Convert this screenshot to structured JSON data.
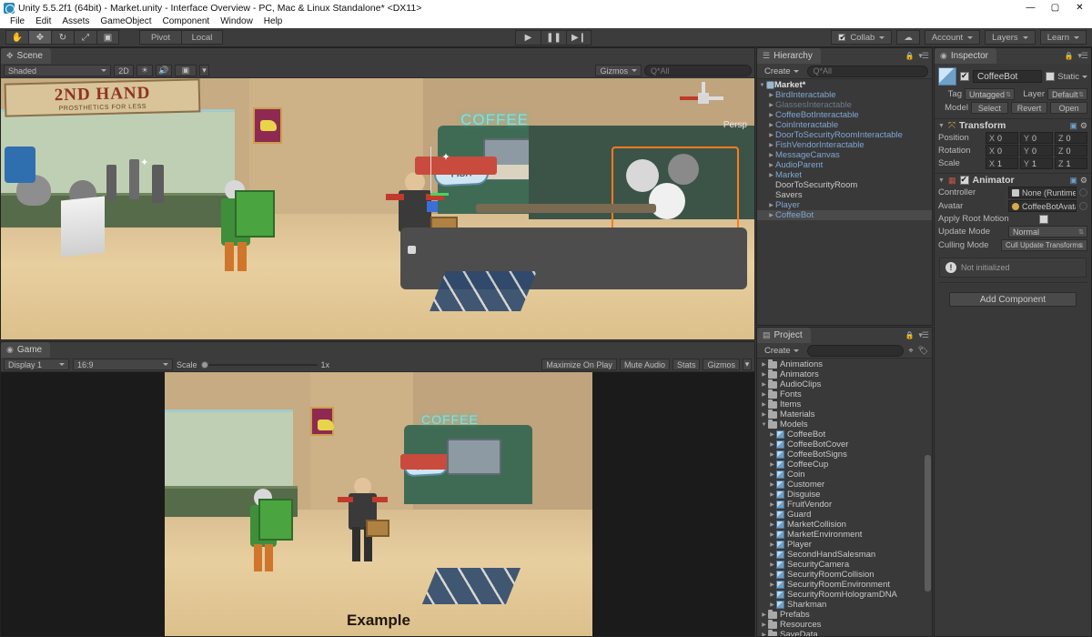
{
  "window": {
    "title": "Unity 5.5.2f1 (64bit) - Market.unity - Interface Overview - PC, Mac & Linux Standalone* <DX11>",
    "minimize": "—",
    "maximize": "▢",
    "close": "✕"
  },
  "menu": {
    "items": [
      "File",
      "Edit",
      "Assets",
      "GameObject",
      "Component",
      "Window",
      "Help"
    ]
  },
  "toolbar": {
    "tools": [
      {
        "name": "hand-tool",
        "glyph": "✋"
      },
      {
        "name": "move-tool",
        "glyph": "✥"
      },
      {
        "name": "rotate-tool",
        "glyph": "↻"
      },
      {
        "name": "scale-tool",
        "glyph": "⤢"
      },
      {
        "name": "rect-tool",
        "glyph": "▣"
      }
    ],
    "pivot_label": "Pivot",
    "space_label": "Local",
    "play": "▶",
    "pause": "❚❚",
    "step": "▶❙",
    "collab": "Collab",
    "cloud": "☁",
    "account": "Account",
    "layers": "Layers",
    "layout": "Learn"
  },
  "scene": {
    "tab": "Scene",
    "shading": "Shaded",
    "twod": "2D",
    "light_icon": "☀",
    "audio_icon": "🔊",
    "fx_icon": "▣",
    "gizmos": "Gizmos",
    "search_placeholder": "Q*All",
    "persp_label": "Persp",
    "art": {
      "sign_line1": "2ND HAND",
      "sign_line2": "PROSTHETICS FOR LESS",
      "coffee_sign": "COFFEE",
      "fish_sign": "FISH"
    }
  },
  "game": {
    "tab": "Game",
    "display": "Display 1",
    "aspect": "16:9",
    "scale_label": "Scale",
    "scale_value": "1x",
    "maximize_on_play": "Maximize On Play",
    "mute_audio": "Mute Audio",
    "stats": "Stats",
    "gizmos": "Gizmos",
    "overlay_text": "Example"
  },
  "hierarchy": {
    "tab": "Hierarchy",
    "create": "Create",
    "search_placeholder": "Q*All",
    "root": "Market*",
    "items": [
      {
        "label": "BirdInteractable",
        "style": "prefab",
        "expandable": true,
        "indent": 1
      },
      {
        "label": "GlassesInteractable",
        "style": "disabled",
        "expandable": true,
        "indent": 1
      },
      {
        "label": "CoffeeBotInteractable",
        "style": "prefab",
        "expandable": true,
        "indent": 1
      },
      {
        "label": "CoinInteractable",
        "style": "prefab",
        "expandable": true,
        "indent": 1
      },
      {
        "label": "DoorToSecurityRoomInteractable",
        "style": "prefab",
        "expandable": true,
        "indent": 1
      },
      {
        "label": "FishVendorInteractable",
        "style": "prefab",
        "expandable": true,
        "indent": 1
      },
      {
        "label": "MessageCanvas",
        "style": "prefab",
        "expandable": true,
        "indent": 1
      },
      {
        "label": "AudioParent",
        "style": "prefab",
        "expandable": true,
        "indent": 1
      },
      {
        "label": "Market",
        "style": "prefab",
        "expandable": true,
        "indent": 1
      },
      {
        "label": "DoorToSecurityRoom",
        "style": "plain",
        "expandable": false,
        "indent": 1
      },
      {
        "label": "Savers",
        "style": "plain",
        "expandable": false,
        "indent": 1
      },
      {
        "label": "Player",
        "style": "prefab",
        "expandable": true,
        "indent": 1
      },
      {
        "label": "CoffeeBot",
        "style": "prefab",
        "expandable": true,
        "indent": 1,
        "selected": true
      }
    ]
  },
  "project": {
    "tab": "Project",
    "create": "Create",
    "search_placeholder": "",
    "items": [
      {
        "label": "Animations",
        "type": "folder",
        "indent": 0,
        "expandable": true
      },
      {
        "label": "Animators",
        "type": "folder",
        "indent": 0,
        "expandable": true
      },
      {
        "label": "AudioClips",
        "type": "folder",
        "indent": 0,
        "expandable": true
      },
      {
        "label": "Fonts",
        "type": "folder",
        "indent": 0,
        "expandable": true
      },
      {
        "label": "Items",
        "type": "folder",
        "indent": 0,
        "expandable": true
      },
      {
        "label": "Materials",
        "type": "folder",
        "indent": 0,
        "expandable": true
      },
      {
        "label": "Models",
        "type": "folder",
        "indent": 0,
        "expandable": true,
        "expanded": true
      },
      {
        "label": "CoffeeBot",
        "type": "prefab",
        "indent": 1,
        "expandable": true
      },
      {
        "label": "CoffeeBotCover",
        "type": "prefab",
        "indent": 1,
        "expandable": true
      },
      {
        "label": "CoffeeBotSigns",
        "type": "prefab",
        "indent": 1,
        "expandable": true
      },
      {
        "label": "CoffeeCup",
        "type": "prefab",
        "indent": 1,
        "expandable": true
      },
      {
        "label": "Coin",
        "type": "prefab",
        "indent": 1,
        "expandable": true
      },
      {
        "label": "Customer",
        "type": "prefab",
        "indent": 1,
        "expandable": true
      },
      {
        "label": "Disguise",
        "type": "prefab",
        "indent": 1,
        "expandable": true
      },
      {
        "label": "FruitVendor",
        "type": "prefab",
        "indent": 1,
        "expandable": true
      },
      {
        "label": "Guard",
        "type": "prefab",
        "indent": 1,
        "expandable": true
      },
      {
        "label": "MarketCollision",
        "type": "prefab",
        "indent": 1,
        "expandable": true
      },
      {
        "label": "MarketEnvironment",
        "type": "prefab",
        "indent": 1,
        "expandable": true
      },
      {
        "label": "Player",
        "type": "prefab",
        "indent": 1,
        "expandable": true
      },
      {
        "label": "SecondHandSalesman",
        "type": "prefab",
        "indent": 1,
        "expandable": true
      },
      {
        "label": "SecurityCamera",
        "type": "prefab",
        "indent": 1,
        "expandable": true
      },
      {
        "label": "SecurityRoomCollision",
        "type": "prefab",
        "indent": 1,
        "expandable": true
      },
      {
        "label": "SecurityRoomEnvironment",
        "type": "prefab",
        "indent": 1,
        "expandable": true
      },
      {
        "label": "SecurityRoomHologramDNA",
        "type": "prefab",
        "indent": 1,
        "expandable": true
      },
      {
        "label": "Sharkman",
        "type": "prefab",
        "indent": 1,
        "expandable": true
      },
      {
        "label": "Prefabs",
        "type": "folder",
        "indent": 0,
        "expandable": true
      },
      {
        "label": "Resources",
        "type": "folder",
        "indent": 0,
        "expandable": true
      },
      {
        "label": "SaveData",
        "type": "folder",
        "indent": 0,
        "expandable": true
      }
    ]
  },
  "inspector": {
    "tab": "Inspector",
    "object_name": "CoffeeBot",
    "enabled": true,
    "static_label": "Static",
    "tag_label": "Tag",
    "tag_value": "Untagged",
    "layer_label": "Layer",
    "layer_value": "Default",
    "model_label": "Model",
    "model_buttons": [
      "Select",
      "Revert",
      "Open"
    ],
    "transform": {
      "title": "Transform",
      "rows": [
        {
          "label": "Position",
          "x": "0",
          "y": "0",
          "z": "0"
        },
        {
          "label": "Rotation",
          "x": "0",
          "y": "0",
          "z": "0"
        },
        {
          "label": "Scale",
          "x": "1",
          "y": "1",
          "z": "1"
        }
      ],
      "axes": [
        "X",
        "Y",
        "Z"
      ]
    },
    "animator": {
      "title": "Animator",
      "enabled": true,
      "controller_label": "Controller",
      "controller_value": "None (Runtime An",
      "avatar_label": "Avatar",
      "avatar_value": "CoffeeBotAvatar",
      "apply_root_motion_label": "Apply Root Motion",
      "apply_root_motion": false,
      "update_mode_label": "Update Mode",
      "update_mode_value": "Normal",
      "culling_mode_label": "Culling Mode",
      "culling_mode_value": "Cull Update Transforms",
      "info": "Not initialized"
    },
    "add_component": "Add Component"
  },
  "colors": {
    "accent_orange": "#ff7b1a",
    "prefab_blue": "#7fa6d4",
    "panel_bg": "#393939",
    "toolbar_bg": "#3c3c3c"
  }
}
